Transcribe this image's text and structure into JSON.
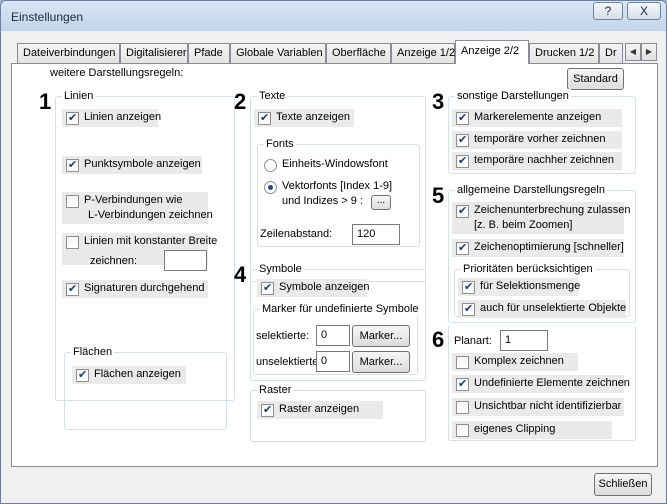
{
  "window": {
    "title": "Einstellungen",
    "help_label": "?",
    "close_label": "X"
  },
  "tabs": [
    {
      "label": "Dateiverbindungen"
    },
    {
      "label": "Digitalisierer"
    },
    {
      "label": "Pfade"
    },
    {
      "label": "Globale Variablen"
    },
    {
      "label": "Oberfläche"
    },
    {
      "label": "Anzeige 1/2"
    },
    {
      "label": "Anzeige 2/2"
    },
    {
      "label": "Drucken 1/2"
    },
    {
      "label": "Dr"
    }
  ],
  "tab_arrows": {
    "left": "◀",
    "right": "▶"
  },
  "page": {
    "heading": "weitere Darstellungsregeln:",
    "standard_button": "Standard"
  },
  "linien": {
    "number": "1",
    "title": "Linien",
    "linien_anzeigen": {
      "label": "Linien anzeigen",
      "checked": true
    },
    "punktsymbole": {
      "label": "Punktsymbole anzeigen",
      "checked": true
    },
    "p_verbindungen": {
      "line1": "P-Verbindungen wie",
      "line2": "L-Verbindungen zeichnen",
      "checked": false
    },
    "konstante_breite": {
      "line1": "Linien mit konstanter Breite",
      "line2": "zeichnen:",
      "checked": false,
      "value": ""
    },
    "signaturen": {
      "label": "Signaturen durchgehend",
      "checked": true
    }
  },
  "flaechen": {
    "title": "Flächen",
    "anzeigen": {
      "label": "Flächen anzeigen",
      "checked": true
    }
  },
  "texte": {
    "number": "2",
    "title": "Texte",
    "anzeigen": {
      "label": "Texte anzeigen",
      "checked": true
    },
    "fonts_title": "Fonts",
    "einheits": {
      "label": "Einheits-Windowsfont",
      "selected": false
    },
    "vektor": {
      "line1": "Vektorfonts [Index 1-9]",
      "line2": "und Indizes > 9 :",
      "selected": true
    },
    "ellipsis_button": "...",
    "zeilenabstand_label": "Zeilenabstand:",
    "zeilenabstand_value": "120"
  },
  "symbole": {
    "number": "4",
    "title": "Symbole",
    "anzeigen": {
      "label": "Symbole anzeigen",
      "checked": true
    },
    "marker_title": "Marker für undefinierte Symbole",
    "selektierte_label": "selektierte:",
    "selektierte_value": "0",
    "unselektierte_label": "unselektierte:",
    "unselektierte_value": "0",
    "marker_button": "Marker..."
  },
  "raster": {
    "title": "Raster",
    "anzeigen": {
      "label": "Raster anzeigen",
      "checked": true
    }
  },
  "sonstige": {
    "number": "3",
    "title": "sonstige Darstellungen",
    "markerelemente": {
      "label": "Markerelemente anzeigen",
      "checked": true
    },
    "vorher": {
      "label": "temporäre vorher zeichnen",
      "checked": true
    },
    "nachher": {
      "label": "temporäre nachher zeichnen",
      "checked": true
    }
  },
  "allgemeine": {
    "number": "5",
    "title": "allgemeine Darstellungsregeln",
    "unterbrechung": {
      "line1": "Zeichenunterbrechung zulassen",
      "line2": "[z. B. beim Zoomen]",
      "checked": true
    },
    "optimierung": {
      "label": "Zeichenoptimierung [schneller]",
      "checked": true
    },
    "prioritaeten_title": "Prioritäten berücksichtigen",
    "selektionsmenge": {
      "label": "für Selektionsmenge",
      "checked": true
    },
    "unselektierte": {
      "label": "auch für unselektierte Objekte",
      "checked": true
    }
  },
  "planart": {
    "number": "6",
    "label": "Planart:",
    "value": "1",
    "komplex": {
      "label": "Komplex zeichnen",
      "checked": false
    },
    "undefinierte": {
      "label": "Undefinierte Elemente zeichnen",
      "checked": true
    },
    "unsichtbar": {
      "label": "Unsichtbar nicht identifizierbar",
      "checked": false
    },
    "clipping": {
      "label": "eigenes Clipping",
      "checked": false
    }
  },
  "footer": {
    "close_button": "Schließen"
  }
}
